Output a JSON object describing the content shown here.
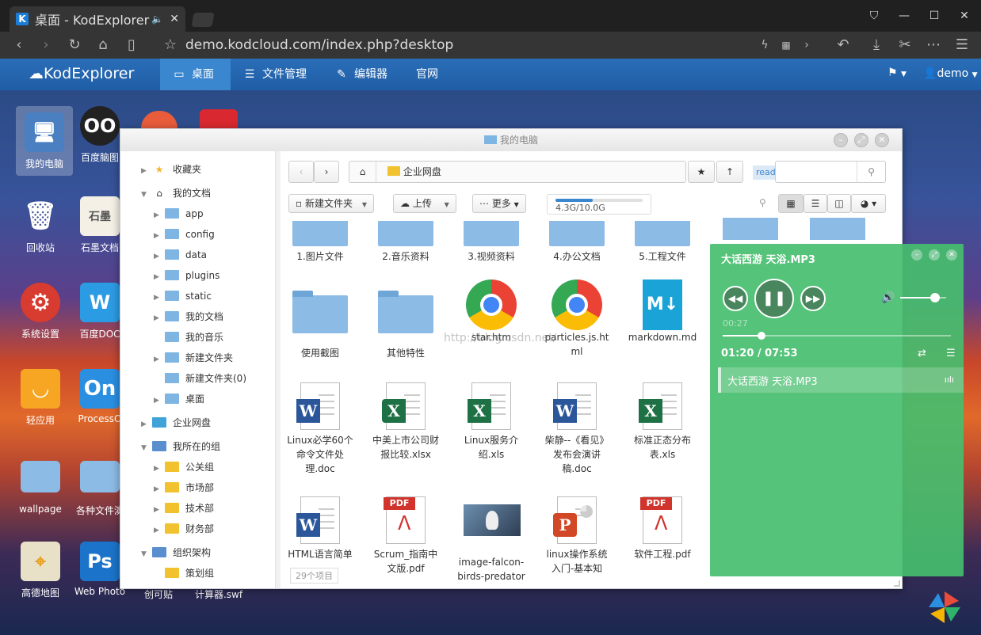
{
  "browser": {
    "tab_title": "桌面 - KodExplorer",
    "tab_sound": "🔈",
    "tab_close": "✕",
    "url": "demo.kodcloud.com/index.php?desktop"
  },
  "topbar": {
    "logo": "KodExplorer",
    "menu": [
      {
        "label": "桌面",
        "icon": "desktop-icon"
      },
      {
        "label": "文件管理",
        "icon": "list-icon"
      },
      {
        "label": "编辑器",
        "icon": "edit-icon"
      },
      {
        "label": "官网",
        "icon": ""
      }
    ],
    "user": "demo"
  },
  "desktop": {
    "icons": [
      {
        "label": "我的电脑"
      },
      {
        "label": "百度脑图"
      },
      {
        "label": "回收站"
      },
      {
        "label": "石墨文档"
      },
      {
        "label": "系统设置"
      },
      {
        "label": "百度DOC"
      },
      {
        "label": "轻应用"
      },
      {
        "label": "ProcessO"
      },
      {
        "label": "wallpage"
      },
      {
        "label": "各种文件演"
      },
      {
        "label": "高德地图"
      },
      {
        "label": "Web Photo"
      },
      {
        "label": "创可贴"
      },
      {
        "label": "计算器.swf"
      }
    ]
  },
  "window": {
    "title": "我的电脑",
    "tree": [
      {
        "label": "收藏夹"
      },
      {
        "label": "我的文档"
      },
      {
        "label": "app"
      },
      {
        "label": "config"
      },
      {
        "label": "data"
      },
      {
        "label": "plugins"
      },
      {
        "label": "static"
      },
      {
        "label": "我的文档"
      },
      {
        "label": "我的音乐"
      },
      {
        "label": "新建文件夹"
      },
      {
        "label": "新建文件夹(0)"
      },
      {
        "label": "桌面"
      },
      {
        "label": "企业网盘"
      },
      {
        "label": "我所在的组"
      },
      {
        "label": "公关组"
      },
      {
        "label": "市场部"
      },
      {
        "label": "技术部"
      },
      {
        "label": "财务部"
      },
      {
        "label": "组织架构"
      },
      {
        "label": "策划组"
      }
    ],
    "path": "企业网盘",
    "search_placeholder": "read",
    "toolbar": {
      "new_folder": "新建文件夹",
      "upload": "上传",
      "more": "更多",
      "storage": "4.3G/10.0G",
      "storage_fraction": 0.43
    },
    "files": [
      {
        "name": "1.图片文件"
      },
      {
        "name": "2.音乐资料"
      },
      {
        "name": "3.视频资料"
      },
      {
        "name": "4.办公文档"
      },
      {
        "name": "5.工程文件"
      },
      {
        "name": "使用截图"
      },
      {
        "name": "其他特性"
      },
      {
        "name": "star.htm"
      },
      {
        "name": "particles.js.html"
      },
      {
        "name": "markdown.md"
      },
      {
        "name": "Linux必学60个命令文件处理.doc"
      },
      {
        "name": "中美上市公司财报比较.xlsx"
      },
      {
        "name": "Linux服务介绍.xls"
      },
      {
        "name": "柴静--《看见》发布会演讲稿.doc"
      },
      {
        "name": "标准正态分布表.xls"
      },
      {
        "name": "HTML语言简单"
      },
      {
        "name": "Scrum_指南中文版.pdf"
      },
      {
        "name": "image-falcon-birds-predator-sky.jpg"
      },
      {
        "name": "linux操作系统入门-基本知识.ppt"
      },
      {
        "name": "软件工程.pdf"
      }
    ],
    "item_count": "29个项目",
    "watermark": "http://blog.csdn.net/"
  },
  "player": {
    "title": "大话西游 天浴.MP3",
    "elapsed_small": "00:27",
    "time": "01:20 / 07:53",
    "progress_fraction": 0.17,
    "volume_fraction": 0.75,
    "playlist": [
      {
        "name": "大话西游 天浴.MP3"
      }
    ]
  },
  "colors": {
    "topbar": "#1f5ea6",
    "player": "#46be6e",
    "storage_bar": "#3a86cf"
  }
}
